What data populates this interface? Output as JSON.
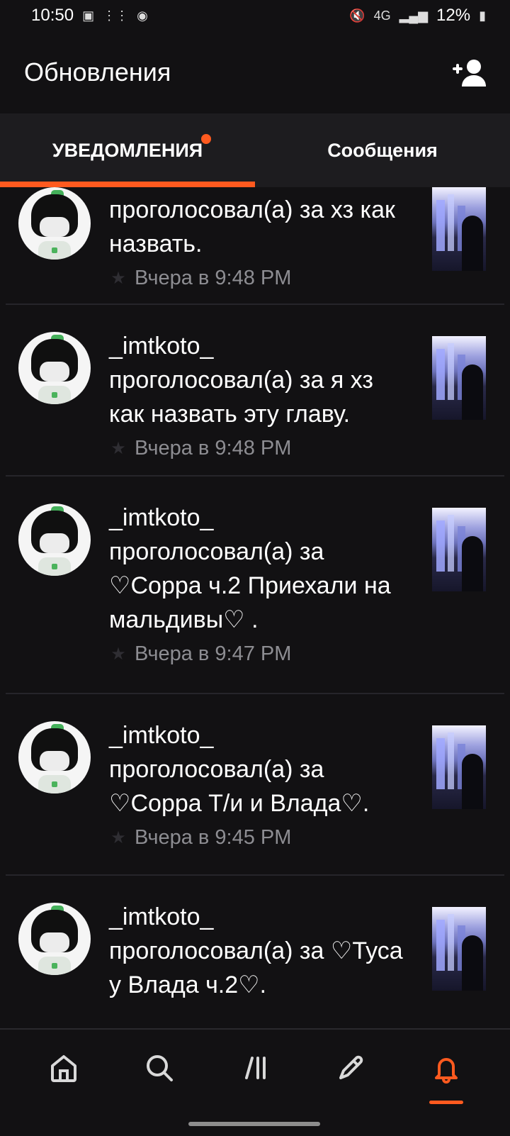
{
  "status_bar": {
    "time": "10:50",
    "network": "4G",
    "battery": "12%"
  },
  "header": {
    "title": "Обновления",
    "add_user_icon": "add-user-icon"
  },
  "tabs": [
    {
      "label": "УВЕДОМЛЕНИЯ",
      "active": true,
      "has_dot": true
    },
    {
      "label": "Сообщения",
      "active": false,
      "has_dot": false
    }
  ],
  "feed": {
    "items": [
      {
        "username": "",
        "action": "проголосовал(а) за хз как назвать.",
        "time": "Вчера в 9:48 PM"
      },
      {
        "username": "_imtkoto_",
        "action": "проголосовал(а) за я хз как назвать эту главу.",
        "time": "Вчера в 9:48 PM"
      },
      {
        "username": "_imtkoto_",
        "action": "проголосовал(а) за ♡Сорра ч.2 Приехали на мальдивы♡ .",
        "time": "Вчера в 9:47 PM"
      },
      {
        "username": "_imtkoto_",
        "action": "проголосовал(а) за ♡Сорра Т/и и Влада♡.",
        "time": "Вчера в 9:45 PM"
      },
      {
        "username": "_imtkoto_",
        "action": "проголосовал(а) за ♡Туса у Влада ч.2♡.",
        "time": ""
      }
    ]
  },
  "bottom_nav": [
    {
      "name": "home-icon"
    },
    {
      "name": "search-icon"
    },
    {
      "name": "library-icon"
    },
    {
      "name": "write-icon"
    },
    {
      "name": "bell-icon",
      "active": true
    }
  ],
  "colors": {
    "accent": "#ff5a1f",
    "background": "#121113",
    "tab_bar": "#1d1c1f"
  }
}
